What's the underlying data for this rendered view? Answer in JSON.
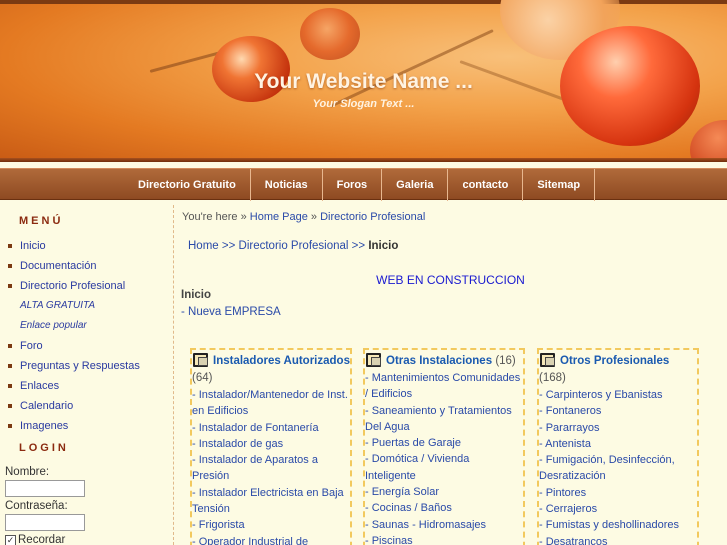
{
  "header": {
    "site_name": "Your Website Name ...",
    "slogan": "Your Slogan Text ..."
  },
  "nav": {
    "items": [
      "Directorio Gratuito",
      "Noticias",
      "Foros",
      "Galeria",
      "contacto",
      "Sitemap"
    ]
  },
  "sidebar": {
    "menu_heading": "MENÚ",
    "menu_items": [
      {
        "label": "Inicio",
        "type": "main"
      },
      {
        "label": "Documentación",
        "type": "main"
      },
      {
        "label": "Directorio Profesional",
        "type": "main"
      },
      {
        "label": "ALTA GRATUITA",
        "type": "sub"
      },
      {
        "label": "Enlace popular",
        "type": "sub"
      },
      {
        "label": "Foro",
        "type": "main"
      },
      {
        "label": "Preguntas y Respuestas",
        "type": "main"
      },
      {
        "label": "Enlaces",
        "type": "main"
      },
      {
        "label": "Calendario",
        "type": "main"
      },
      {
        "label": "Imagenes",
        "type": "main"
      }
    ],
    "login_heading": "LOGIN",
    "login": {
      "name_label": "Nombre:",
      "password_label": "Contraseña:",
      "remember_label": "Recordar"
    }
  },
  "main": {
    "breadcrumb": {
      "prefix": "You're here »",
      "home": "Home Page",
      "sep": "»",
      "current": "Directorio Profesional"
    },
    "path": {
      "home": "Home",
      "sep1": ">>",
      "dir": "Directorio Profesional",
      "sep2": ">>",
      "current": "Inicio"
    },
    "construction": "WEB EN CONSTRUCCION",
    "inicio": "Inicio",
    "nueva_empresa": "- Nueva EMPRESA",
    "categories": [
      {
        "title": "Instaladores Autorizados",
        "count": "(64)",
        "items": [
          "- Instalador/Mantenedor de Inst. en Edificios",
          "- Instalador de Fontanería",
          "- Instalador de gas",
          "- Instalador de Aparatos a Presión",
          "- Instalador Electricista en Baja Tensión",
          "- Frigorista",
          "- Operador Industrial de"
        ]
      },
      {
        "title": "Otras Instalaciones",
        "count": "(16)",
        "items": [
          "- Mantenimientos Comunidades / Edificios",
          "- Saneamiento y Tratamientos Del Agua",
          "- Puertas de Garaje",
          "- Domótica / Vivienda Inteligente",
          "- Energía Solar",
          "- Cocinas / Baños",
          "- Saunas - Hidromasajes",
          "- Piscinas"
        ]
      },
      {
        "title": "Otros Profesionales",
        "count": "(168)",
        "items": [
          "- Carpinteros y Ebanistas",
          "- Fontaneros",
          "- Pararrayos",
          "- Antenista",
          "- Fumigación, Desinfección, Desratización",
          "- Pintores",
          "- Cerrajeros",
          "- Fumistas y deshollinadores",
          "- Desatrancos"
        ]
      }
    ]
  }
}
